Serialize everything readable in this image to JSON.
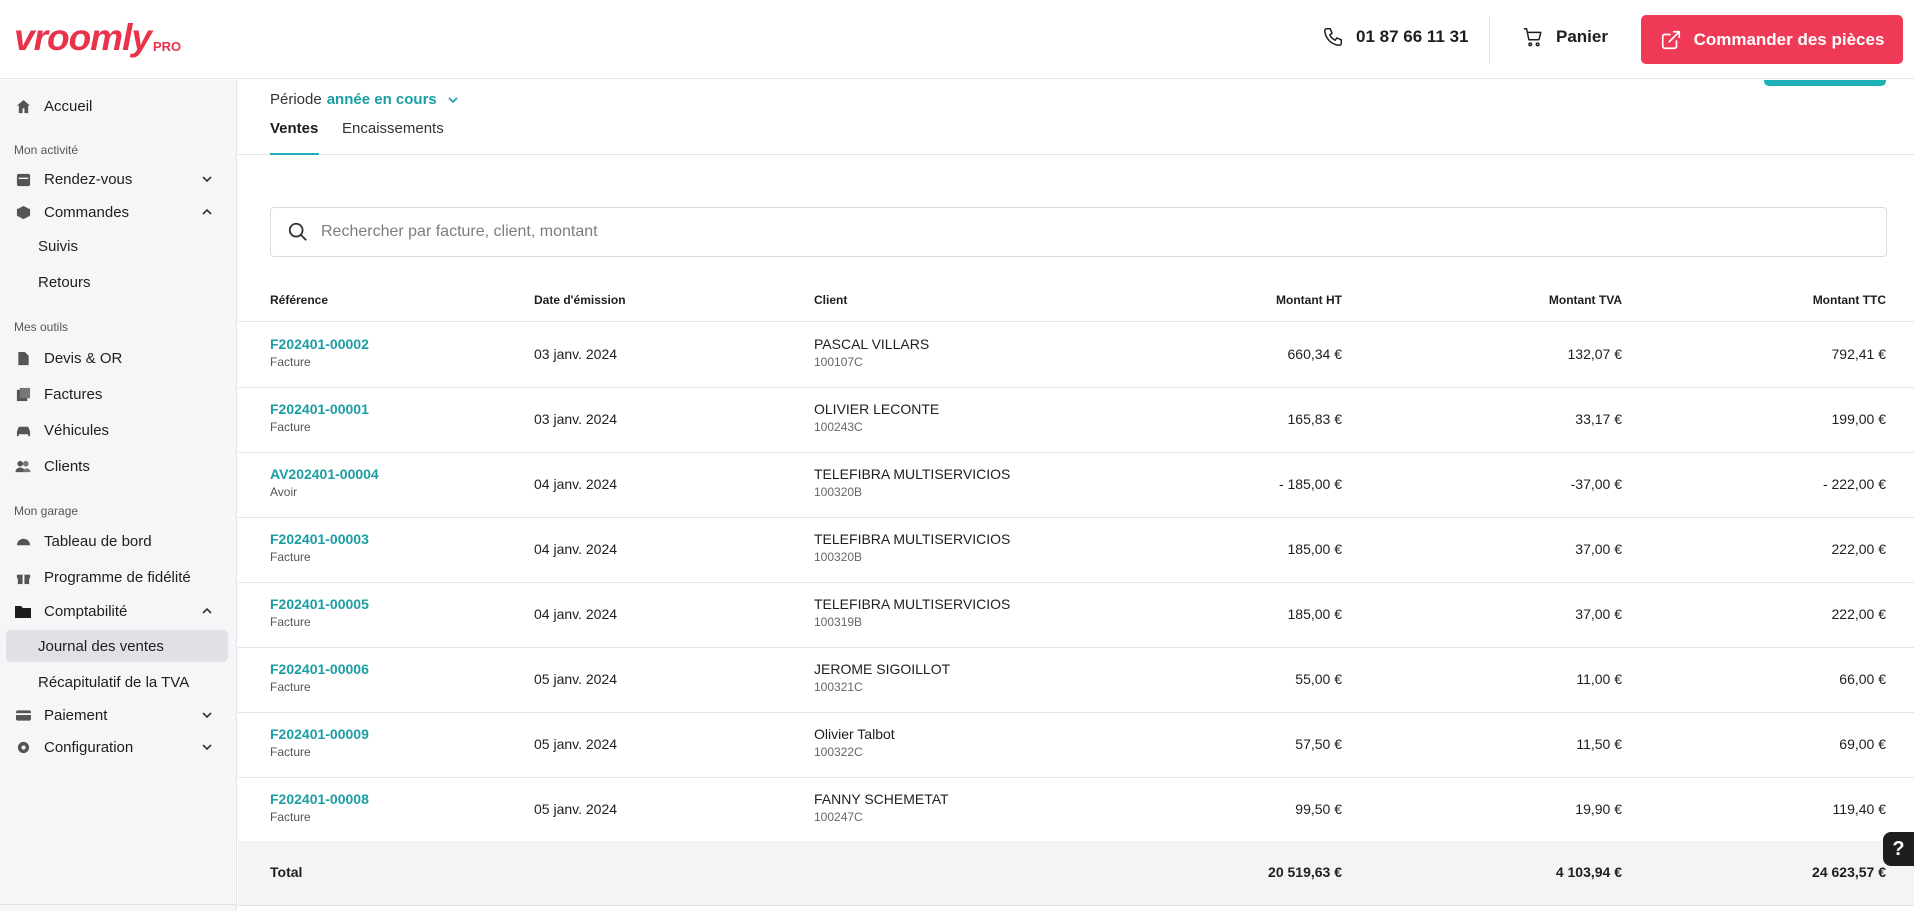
{
  "header": {
    "logo": "vroomly",
    "logo_badge": "PRO",
    "phone": "01 87 66 11 31",
    "cart_label": "Panier",
    "order_button": "Commander des pièces"
  },
  "sidebar": {
    "home": "Accueil",
    "sections": {
      "activity": "Mon activité",
      "tools": "Mes outils",
      "garage": "Mon garage"
    },
    "items": {
      "rendezvous": "Rendez-vous",
      "commandes": "Commandes",
      "suivis": "Suivis",
      "retours": "Retours",
      "devis": "Devis & OR",
      "factures": "Factures",
      "vehicules": "Véhicules",
      "clients": "Clients",
      "tableau": "Tableau de bord",
      "fidelite": "Programme de fidélité",
      "comptabilite": "Comptabilité",
      "journal": "Journal des ventes",
      "recap_tva": "Récapitulatif de la TVA",
      "paiement": "Paiement",
      "configuration": "Configuration"
    }
  },
  "main": {
    "period_label": "Période",
    "period_value": "année en cours",
    "tabs": [
      "Ventes",
      "Encaissements"
    ],
    "search_placeholder": "Rechercher par facture, client, montant",
    "columns": [
      "Référence",
      "Date d'émission",
      "Client",
      "Montant HT",
      "Montant TVA",
      "Montant TTC"
    ],
    "rows": [
      {
        "ref": "F202401-00002",
        "kind": "Facture",
        "date": "03 janv. 2024",
        "client": "PASCAL VILLARS",
        "code": "100107C",
        "ht": "660,34 €",
        "tva": "132,07 €",
        "ttc": "792,41 €"
      },
      {
        "ref": "F202401-00001",
        "kind": "Facture",
        "date": "03 janv. 2024",
        "client": "OLIVIER LECONTE",
        "code": "100243C",
        "ht": "165,83 €",
        "tva": "33,17 €",
        "ttc": "199,00 €"
      },
      {
        "ref": "AV202401-00004",
        "kind": "Avoir",
        "date": "04 janv. 2024",
        "client": "TELEFIBRA MULTISERVICIOS",
        "code": "100320B",
        "ht": "- 185,00 €",
        "tva": "-37,00 €",
        "ttc": "- 222,00 €"
      },
      {
        "ref": "F202401-00003",
        "kind": "Facture",
        "date": "04 janv. 2024",
        "client": "TELEFIBRA MULTISERVICIOS",
        "code": "100320B",
        "ht": "185,00 €",
        "tva": "37,00 €",
        "ttc": "222,00 €"
      },
      {
        "ref": "F202401-00005",
        "kind": "Facture",
        "date": "04 janv. 2024",
        "client": "TELEFIBRA MULTISERVICIOS",
        "code": "100319B",
        "ht": "185,00 €",
        "tva": "37,00 €",
        "ttc": "222,00 €"
      },
      {
        "ref": "F202401-00006",
        "kind": "Facture",
        "date": "05 janv. 2024",
        "client": "JEROME SIGOILLOT",
        "code": "100321C",
        "ht": "55,00 €",
        "tva": "11,00 €",
        "ttc": "66,00 €"
      },
      {
        "ref": "F202401-00009",
        "kind": "Facture",
        "date": "05 janv. 2024",
        "client": "Olivier Talbot",
        "code": "100322C",
        "ht": "57,50 €",
        "tva": "11,50 €",
        "ttc": "69,00 €"
      },
      {
        "ref": "F202401-00008",
        "kind": "Facture",
        "date": "05 janv. 2024",
        "client": "FANNY SCHEMETAT",
        "code": "100247C",
        "ht": "99,50 €",
        "tva": "19,90 €",
        "ttc": "119,40 €"
      }
    ],
    "total": {
      "label": "Total",
      "ht": "20 519,63 €",
      "tva": "4 103,94 €",
      "ttc": "24 623,57 €"
    }
  },
  "help_label": "?",
  "colors": {
    "brand": "#e8334a",
    "accent": "#1a9ea4",
    "order_button": "#ef3a57"
  }
}
